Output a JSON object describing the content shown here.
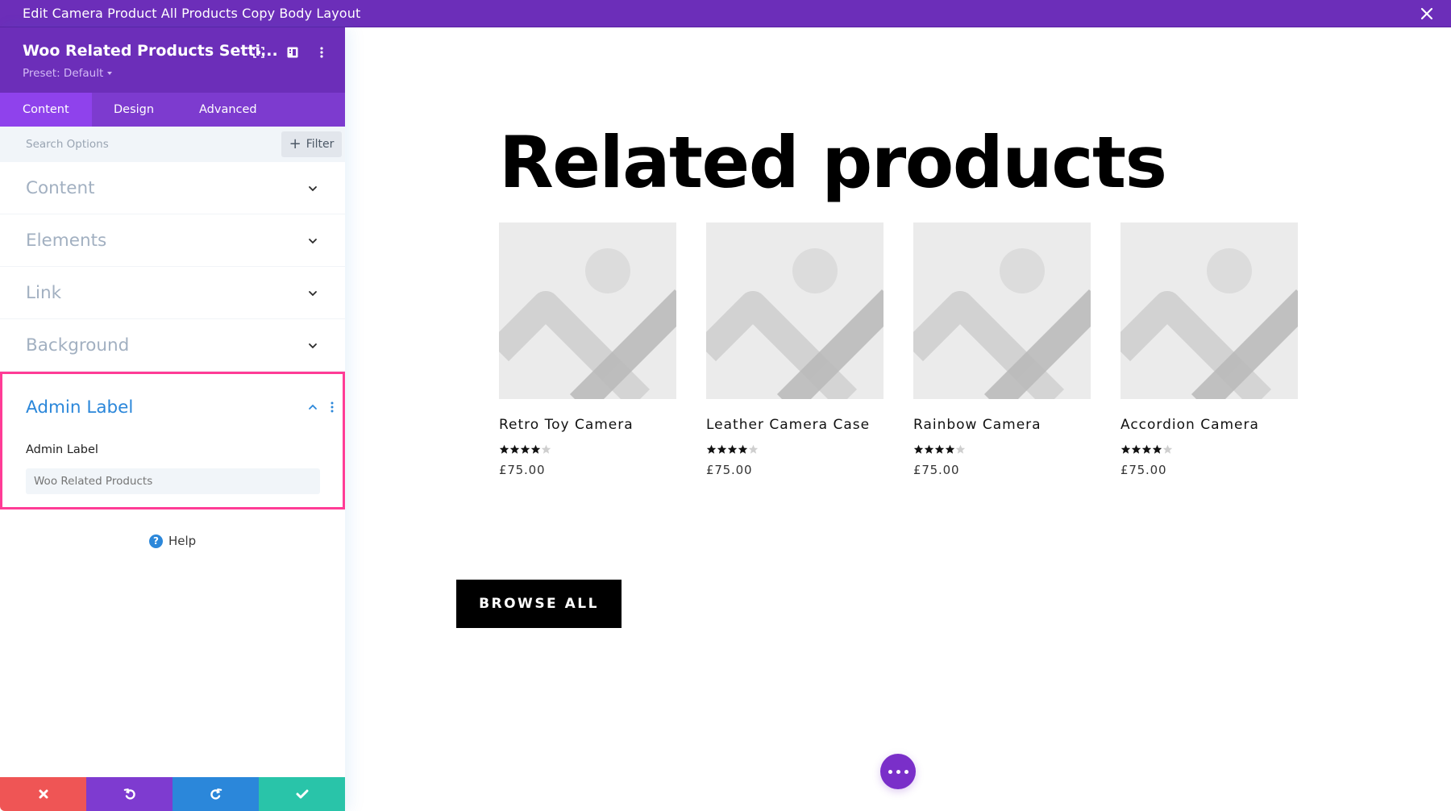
{
  "window": {
    "title": "Edit Camera Product All Products Copy Body Layout",
    "close_icon": "close-icon"
  },
  "sidebar": {
    "title": "Woo Related Products Setti...",
    "preset_label": "Preset: Default",
    "header_icons": [
      "fullscreen-icon",
      "split-view-icon",
      "more-options-icon"
    ],
    "tabs": [
      {
        "label": "Content",
        "active": true
      },
      {
        "label": "Design",
        "active": false
      },
      {
        "label": "Advanced",
        "active": false
      }
    ],
    "search": {
      "placeholder": "Search Options",
      "value": ""
    },
    "filter_label": "Filter",
    "sections": [
      {
        "label": "Content",
        "expanded": false
      },
      {
        "label": "Elements",
        "expanded": false
      },
      {
        "label": "Link",
        "expanded": false
      },
      {
        "label": "Background",
        "expanded": false
      }
    ],
    "admin_section": {
      "title": "Admin Label",
      "expanded": true,
      "field_label": "Admin Label",
      "field_placeholder": "Woo Related Products",
      "field_value": "",
      "highlight_color": "#ff3c96"
    },
    "help_label": "Help",
    "bottom_actions": [
      {
        "name": "cancel",
        "icon": "close-icon",
        "color": "#ef5555"
      },
      {
        "name": "undo",
        "icon": "undo-icon",
        "color": "#7e3bd0"
      },
      {
        "name": "redo",
        "icon": "redo-icon",
        "color": "#2b87da"
      },
      {
        "name": "save",
        "icon": "check-icon",
        "color": "#29c4a9"
      }
    ]
  },
  "canvas": {
    "heading": "Related products",
    "products": [
      {
        "name": "Retro Toy Camera",
        "rating": 4,
        "rating_max": 5,
        "price": "£75.00"
      },
      {
        "name": "Leather Camera Case",
        "rating": 4,
        "rating_max": 5,
        "price": "£75.00"
      },
      {
        "name": "Rainbow Camera",
        "rating": 4,
        "rating_max": 5,
        "price": "£75.00"
      },
      {
        "name": "Accordion Camera",
        "rating": 4,
        "rating_max": 5,
        "price": "£75.00"
      }
    ],
    "browse_button": "BROWSE ALL",
    "fab_icon": "more-horizontal-icon"
  },
  "colors": {
    "brand_purple": "#6c2eb9",
    "tab_active": "#8f42ec",
    "accent_blue": "#2b87da"
  }
}
